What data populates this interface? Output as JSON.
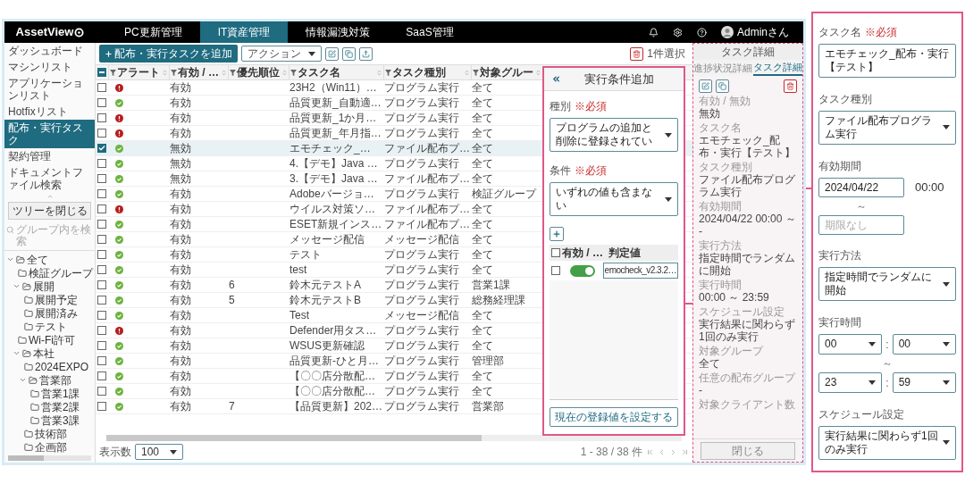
{
  "top_bar": {
    "logo": "AssetView",
    "tabs": [
      {
        "label": "PC更新管理",
        "selected": false
      },
      {
        "label": "IT資産管理",
        "selected": true
      },
      {
        "label": "情報漏洩対策",
        "selected": false
      },
      {
        "label": "SaaS管理",
        "selected": false
      }
    ],
    "user": "Adminさん"
  },
  "sidebar": {
    "items": [
      {
        "label": "ダッシュボード",
        "selected": false
      },
      {
        "label": "マシンリスト",
        "selected": false
      },
      {
        "label": "アプリケーションリスト",
        "selected": false
      },
      {
        "label": "Hotfixリスト",
        "selected": false
      },
      {
        "label": "配布・実行タスク",
        "selected": true
      },
      {
        "label": "契約管理",
        "selected": false
      },
      {
        "label": "ドキュメントファイル検索",
        "selected": false
      }
    ],
    "collapse_button": "ツリーを閉じる",
    "search": {
      "placeholder": "グループ内を検索"
    },
    "tree": [
      {
        "label": "全て",
        "expanded": true,
        "children": [
          {
            "label": "検証グループ"
          },
          {
            "label": "展開",
            "expanded": true,
            "children": [
              {
                "label": "展開予定"
              },
              {
                "label": "展開済み"
              },
              {
                "label": "テスト"
              }
            ]
          },
          {
            "label": "Wi-Fi許可"
          },
          {
            "label": "本社",
            "expanded": true,
            "children": [
              {
                "label": "2024EXPO"
              },
              {
                "label": "営業部",
                "expanded": true,
                "children": [
                  {
                    "label": "営業1課"
                  },
                  {
                    "label": "営業2課"
                  },
                  {
                    "label": "営業3課"
                  }
                ]
              },
              {
                "label": "技術部"
              },
              {
                "label": "企画部"
              }
            ]
          }
        ]
      }
    ]
  },
  "toolbar": {
    "add_button": "配布・実行タスクを追加",
    "action_select": "アクション",
    "selection_count": "1件選択"
  },
  "table": {
    "select_all": {
      "indeterminate": true
    },
    "columns": [
      "アラート",
      "有効 / …",
      "優先順位",
      "タスク名",
      "タスク種別",
      "対象グルー"
    ],
    "rows": [
      {
        "checked": false,
        "selected": false,
        "kind": "error",
        "enabled": "有効",
        "name": "23H2（Win11）…",
        "type": "プログラム実行",
        "target": "全て"
      },
      {
        "checked": false,
        "selected": false,
        "kind": "ok",
        "enabled": "有効",
        "name": "品質更新_自動適…",
        "type": "プログラム実行",
        "target": "全て"
      },
      {
        "checked": false,
        "selected": false,
        "kind": "error",
        "enabled": "有効",
        "name": "品質更新_1か月…",
        "type": "プログラム実行",
        "target": "全て"
      },
      {
        "checked": false,
        "selected": false,
        "kind": "error",
        "enabled": "有効",
        "name": "品質更新_年月指…",
        "type": "プログラム実行",
        "target": "全て"
      },
      {
        "checked": true,
        "selected": true,
        "kind": "ok",
        "enabled": "無効",
        "name": "エモチェック_…",
        "type": "ファイル配布プ…",
        "target": "全て"
      },
      {
        "checked": false,
        "selected": false,
        "kind": "ok",
        "enabled": "無効",
        "name": "4.【デモ】Java …",
        "type": "プログラム実行",
        "target": "全て"
      },
      {
        "checked": false,
        "selected": false,
        "kind": "ok",
        "enabled": "無効",
        "name": "3.【デモ】Java …",
        "type": "ファイル配布プ…",
        "target": "全て"
      },
      {
        "checked": false,
        "selected": false,
        "kind": "ok",
        "enabled": "有効",
        "name": "Adobeバージョ…",
        "type": "プログラム実行",
        "target": "検証グループ"
      },
      {
        "checked": false,
        "selected": false,
        "kind": "error",
        "enabled": "有効",
        "name": "ウイルス対策ソ…",
        "type": "ファイル配布プ…",
        "target": "全て"
      },
      {
        "checked": false,
        "selected": false,
        "kind": "ok",
        "enabled": "有効",
        "name": "ESET新規インス…",
        "type": "ファイル配布プ…",
        "target": "全て"
      },
      {
        "checked": false,
        "selected": false,
        "kind": "ok",
        "enabled": "有効",
        "name": "メッセージ配信",
        "type": "メッセージ配信",
        "target": "全て"
      },
      {
        "checked": false,
        "selected": false,
        "kind": "ok",
        "enabled": "有効",
        "name": "テスト",
        "type": "プログラム実行",
        "target": "全て"
      },
      {
        "checked": false,
        "selected": false,
        "kind": "ok",
        "enabled": "有効",
        "name": "test",
        "type": "プログラム実行",
        "target": "全て"
      },
      {
        "checked": false,
        "selected": false,
        "kind": "ok",
        "enabled": "有効",
        "priority": "6",
        "name": "鈴木元テストA",
        "type": "プログラム実行",
        "target": "営業1課"
      },
      {
        "checked": false,
        "selected": false,
        "kind": "ok",
        "enabled": "有効",
        "priority": "5",
        "name": "鈴木元テストB",
        "type": "プログラム実行",
        "target": "総務経理課"
      },
      {
        "checked": false,
        "selected": false,
        "kind": "ok",
        "enabled": "有効",
        "name": "Test",
        "type": "メッセージ配信",
        "target": "全て"
      },
      {
        "checked": false,
        "selected": false,
        "kind": "error",
        "enabled": "有効",
        "name": "Defender用タス…",
        "type": "プログラム実行",
        "target": "全て"
      },
      {
        "checked": false,
        "selected": false,
        "kind": "ok",
        "enabled": "有効",
        "name": "WSUS更新確認",
        "type": "プログラム実行",
        "target": "全て"
      },
      {
        "checked": false,
        "selected": false,
        "kind": "ok",
        "enabled": "有効",
        "name": "品質更新-ひと月…",
        "type": "プログラム実行",
        "target": "管理部"
      },
      {
        "checked": false,
        "selected": false,
        "kind": "ok",
        "enabled": "有効",
        "name": "【〇〇店分散配…",
        "type": "プログラム実行",
        "target": "全て"
      },
      {
        "checked": false,
        "selected": false,
        "kind": "ok",
        "enabled": "有効",
        "name": "【〇〇店分散配…",
        "type": "プログラム実行",
        "target": "全て"
      },
      {
        "checked": false,
        "selected": false,
        "kind": "ok",
        "enabled": "有効",
        "priority": "7",
        "name": "【品質更新】202…",
        "type": "プログラム実行",
        "target": "営業部"
      }
    ]
  },
  "footer": {
    "page_size_label": "表示数",
    "page_size": "100",
    "range": "1 - 38 / 38 件"
  },
  "dialog": {
    "title": "実行条件追加",
    "kind_field": {
      "label": "種別",
      "required": "※必須",
      "value": "プログラムの追加と削除に登録されてい"
    },
    "condition_field": {
      "label": "条件",
      "required": "※必須",
      "value": "いずれの値も含まない"
    },
    "all_checked": false,
    "columns": [
      "有効 / …",
      "判定値"
    ],
    "rows": [
      {
        "checked": false,
        "on": true,
        "value": "emocheck_v2.3.2…"
      }
    ],
    "set_button": "現在の登録値を設定する"
  },
  "detail_panel": {
    "title": "タスク詳細",
    "tabs": [
      {
        "label": "進捗状況詳細",
        "selected": false
      },
      {
        "label": "タスク詳細",
        "selected": true
      }
    ],
    "fields": [
      {
        "label": "有効 / 無効",
        "value": "無効"
      },
      {
        "label": "タスク名",
        "value": "エモチェック_配布・実行【テスト】"
      },
      {
        "label": "タスク種別",
        "value": "ファイル配布プログラム実行"
      },
      {
        "label": "有効期間",
        "value": "2024/04/22 00:00 ～ -"
      },
      {
        "label": "実行方法",
        "value": "指定時間でランダムに開始"
      },
      {
        "label": "実行時間",
        "value": "00:00 ～ 23:59"
      },
      {
        "label": "スケジュール設定",
        "value": "実行結果に関わらず1回のみ実行"
      },
      {
        "label": "対象グループ",
        "value": "全て"
      },
      {
        "label": "任意の配布グループ",
        "value": "-"
      },
      {
        "label": "対象クライアント数"
      }
    ],
    "close_button": "閉じる"
  },
  "callout": {
    "task_name": {
      "label": "タスク名",
      "required": "※必須",
      "value": "エモチェック_配布・実行【テスト】"
    },
    "task_type": {
      "label": "タスク種別",
      "value": "ファイル配布プログラム実行"
    },
    "period": {
      "label": "有効期間",
      "start_date": "2024/04/22",
      "start_time": "00:00",
      "separator": "～",
      "end_placeholder": "期限なし"
    },
    "method": {
      "label": "実行方法",
      "value": "指定時間でランダムに開始"
    },
    "time": {
      "label": "実行時間",
      "start": {
        "hour": "00",
        "colon": ":",
        "minute": "00"
      },
      "separator": "～",
      "end": {
        "hour": "23",
        "colon": ":",
        "minute": "59"
      }
    },
    "schedule": {
      "label": "スケジュール設定",
      "value": "実行結果に関わらず1回のみ実行"
    }
  }
}
